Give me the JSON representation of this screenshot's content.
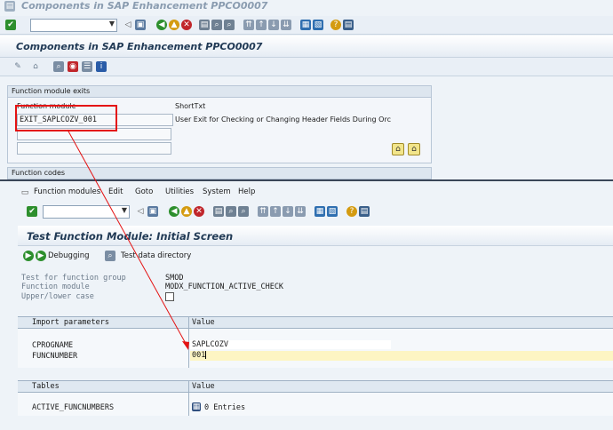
{
  "window_title": "Components in SAP Enhancement PPCO0007",
  "page_title": "Components in SAP Enhancement PPCO0007",
  "function_module_exits": {
    "frame_title": "Function module exits",
    "col_module": "Function module",
    "col_shorttext": "ShortTxt",
    "row1_module": "EXIT_SAPLCOZV_001",
    "row1_text": "User Exit for Checking or Changing Header Fields During Orc"
  },
  "function_codes_frame_title": "Function codes",
  "test_window": {
    "menu": [
      "Function modules",
      "Edit",
      "Goto",
      "Utilities",
      "System",
      "Help"
    ],
    "title": "Test Function Module: Initial Screen",
    "debugging_label": "Debugging",
    "test_data_dir_label": "Test data directory",
    "fg_label": "Test for function group",
    "fg_value": "SMOD",
    "fm_label": "Function module",
    "fm_value": "MODX_FUNCTION_ACTIVE_CHECK",
    "case_label": "Upper/lower case",
    "import_header": "Import parameters",
    "value_header": "Value",
    "param1_name": "CPROGNAME",
    "param1_value": "SAPLCOZV",
    "param2_name": "FUNCNUMBER",
    "param2_value": "001",
    "tables_header": "Tables",
    "tables_value_header": "Value",
    "table1_name": "ACTIVE_FUNCNUMBERS",
    "table1_value": "0 Entries"
  },
  "colors": {
    "highlight": "#e41212",
    "input_yellow": "#fdf5c3"
  }
}
